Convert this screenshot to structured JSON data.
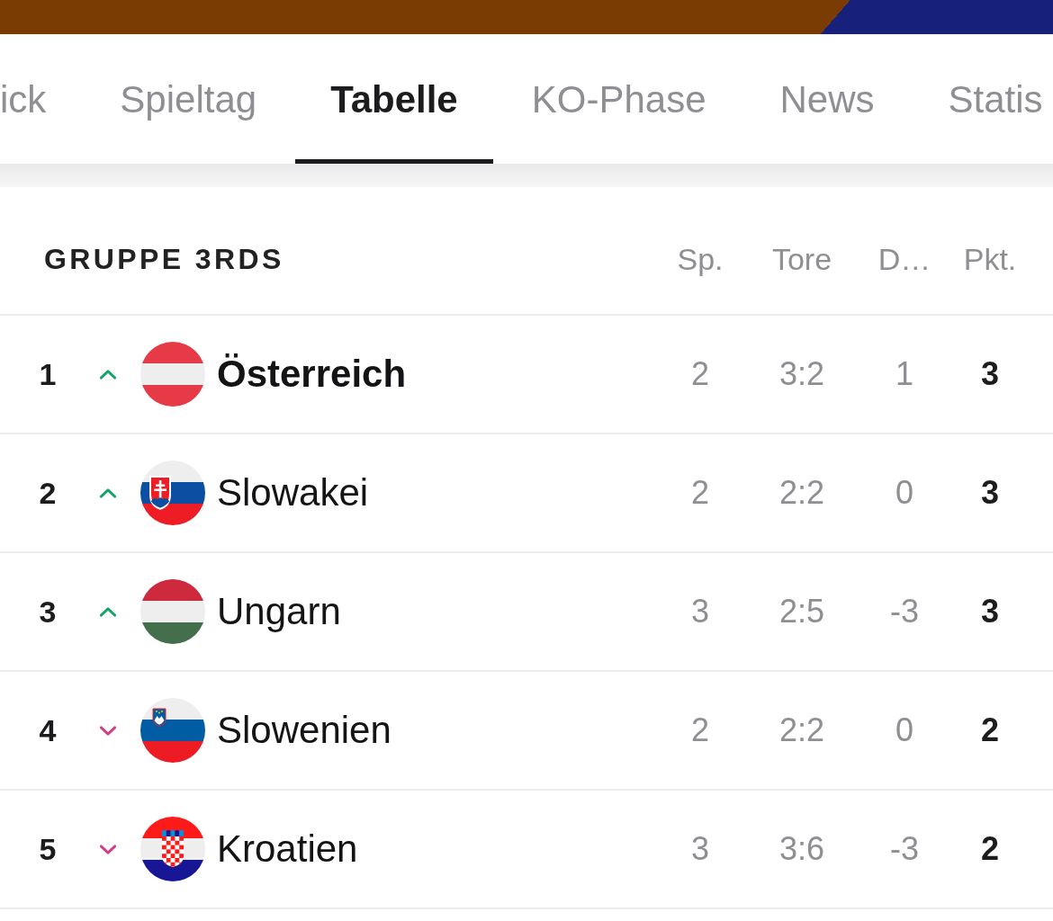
{
  "tabs": [
    {
      "label": "ick",
      "selected": false
    },
    {
      "label": "Spieltag",
      "selected": false
    },
    {
      "label": "Tabelle",
      "selected": true
    },
    {
      "label": "KO-Phase",
      "selected": false
    },
    {
      "label": "News",
      "selected": false
    },
    {
      "label": "Statis",
      "selected": false
    }
  ],
  "group_table": {
    "title": "GRUPPE 3RDS",
    "columns": [
      "Sp.",
      "Tore",
      "D…",
      "Pkt."
    ],
    "rows": [
      {
        "rank": "1",
        "rising": true,
        "kind": "austria",
        "team": "Österreich",
        "highlighted": true,
        "played": "2",
        "goals": "3:2",
        "diff": "1",
        "points": "3"
      },
      {
        "rank": "2",
        "rising": true,
        "kind": "slovakia",
        "team": "Slowakei",
        "highlighted": false,
        "played": "2",
        "goals": "2:2",
        "diff": "0",
        "points": "3"
      },
      {
        "rank": "3",
        "rising": true,
        "kind": "hungary",
        "team": "Ungarn",
        "highlighted": false,
        "played": "3",
        "goals": "2:5",
        "diff": "-3",
        "points": "3"
      },
      {
        "rank": "4",
        "rising": false,
        "kind": "slovenia",
        "team": "Slowenien",
        "highlighted": false,
        "played": "2",
        "goals": "2:2",
        "diff": "0",
        "points": "2"
      },
      {
        "rank": "5",
        "rising": false,
        "kind": "croatia",
        "team": "Kroatien",
        "highlighted": false,
        "played": "3",
        "goals": "3:6",
        "diff": "-3",
        "points": "2"
      }
    ]
  }
}
